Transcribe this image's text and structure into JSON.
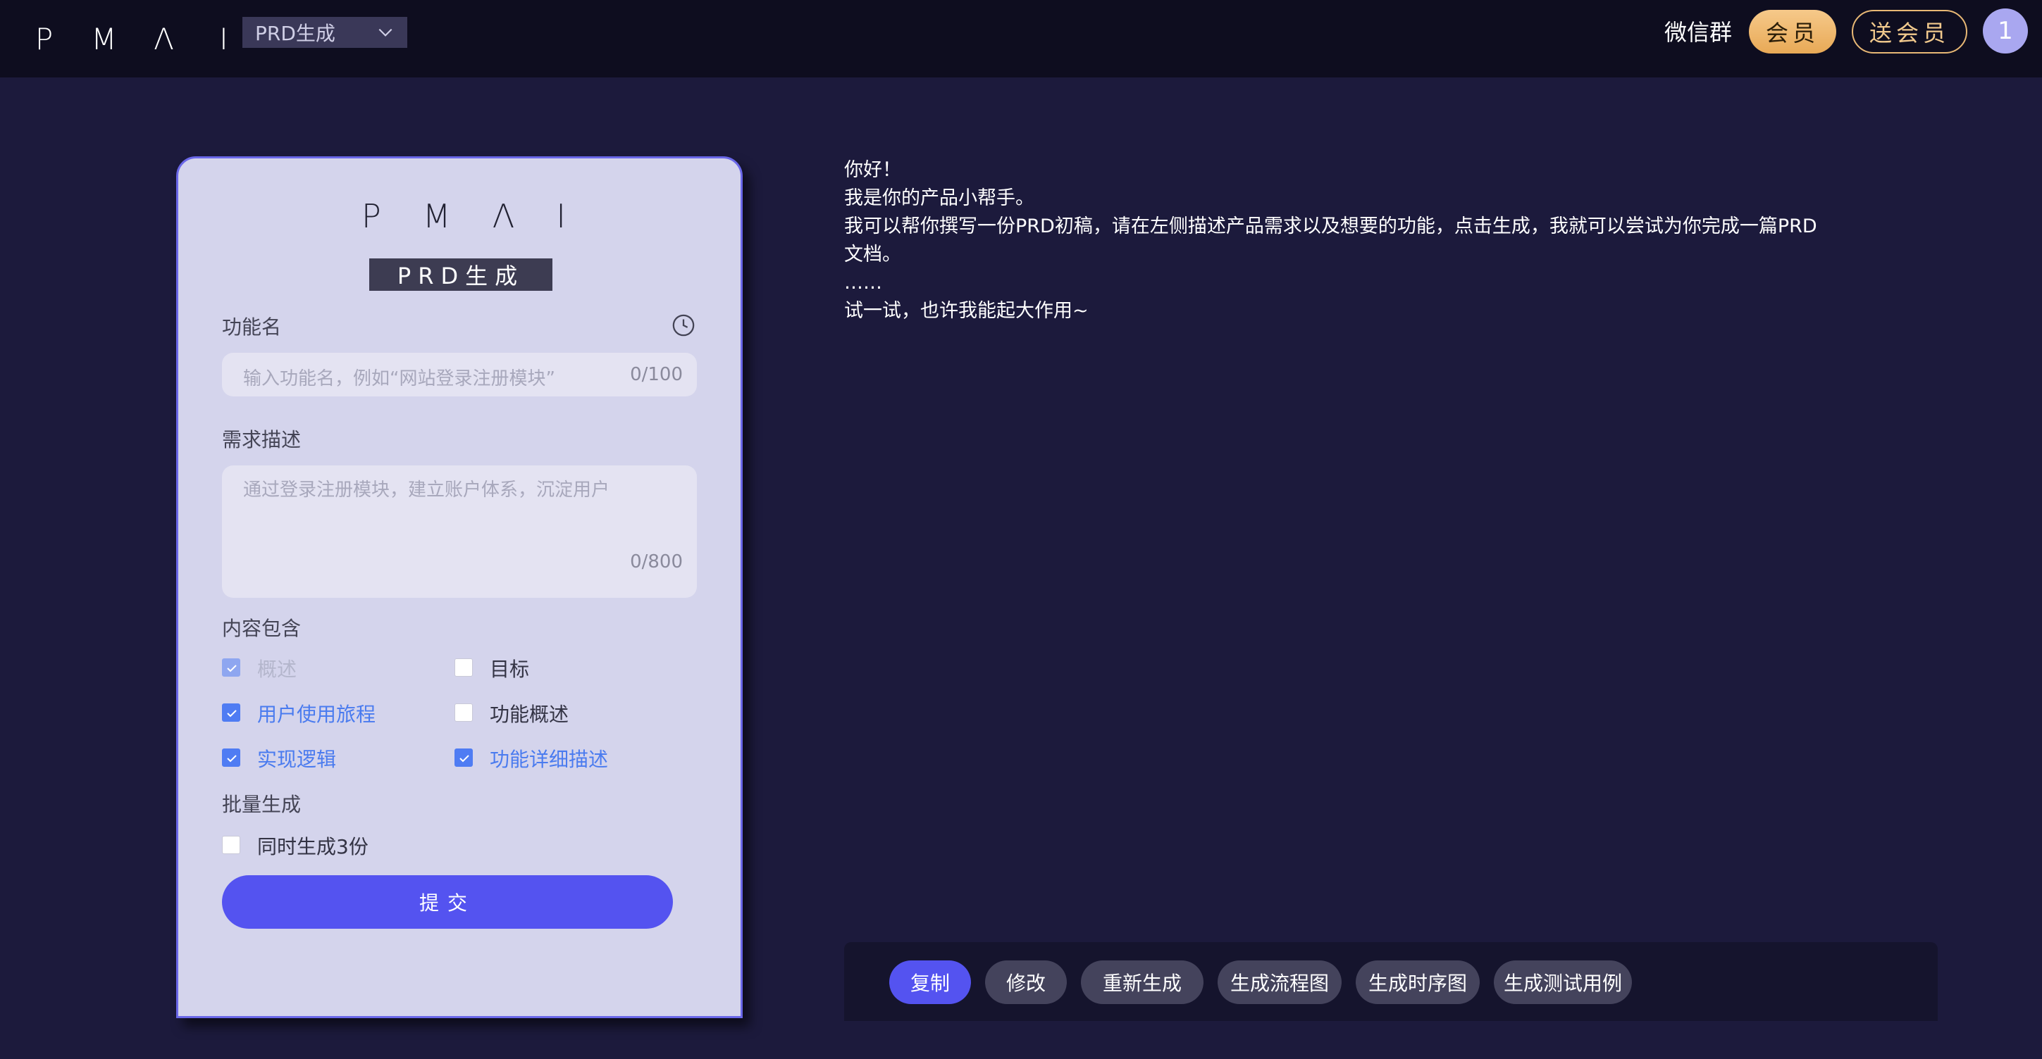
{
  "header": {
    "logo_letters": [
      "P",
      "M",
      "Λ",
      "I"
    ],
    "mode": "PRD生成",
    "wechat": "微信群",
    "member": "会员",
    "gift_member": "送会员",
    "avatar": "1"
  },
  "form": {
    "logo_letters": [
      "P",
      "M",
      "Λ",
      "I"
    ],
    "subtitle": "PRD生成",
    "feature_label": "功能名",
    "feature_placeholder": "输入功能名，例如“网站登录注册模块”",
    "feature_count": "0/100",
    "desc_label": "需求描述",
    "desc_placeholder": "通过登录注册模块，建立账户体系，沉淀用户",
    "desc_count": "0/800",
    "content_label": "内容包含",
    "options": [
      {
        "label": "概述",
        "state": "disabled"
      },
      {
        "label": "目标",
        "state": "unchecked"
      },
      {
        "label": "用户使用旅程",
        "state": "checked"
      },
      {
        "label": "功能概述",
        "state": "unchecked"
      },
      {
        "label": "实现逻辑",
        "state": "checked"
      },
      {
        "label": "功能详细描述",
        "state": "checked"
      }
    ],
    "batch_label": "批量生成",
    "batch_option": "同时生成3份",
    "submit": "提交"
  },
  "output": {
    "lines": [
      "你好！",
      "我是你的产品小帮手。",
      "我可以帮你撰写一份PRD初稿，请在左侧描述产品需求以及想要的功能，点击生成，我就可以尝试为你完成一篇PRD",
      "文档。",
      "……",
      "试一试，也许我能起大作用~"
    ]
  },
  "toolbar": {
    "copy": "复制",
    "edit": "修改",
    "regenerate": "重新生成",
    "flowchart": "生成流程图",
    "sequence": "生成时序图",
    "testcases": "生成测试用例"
  },
  "colors": {
    "background": "#1c1a3c",
    "header": "#0e0d1f",
    "accent": "#5453f0",
    "card": "#d4d4ec",
    "gold": "#f1c98d"
  }
}
